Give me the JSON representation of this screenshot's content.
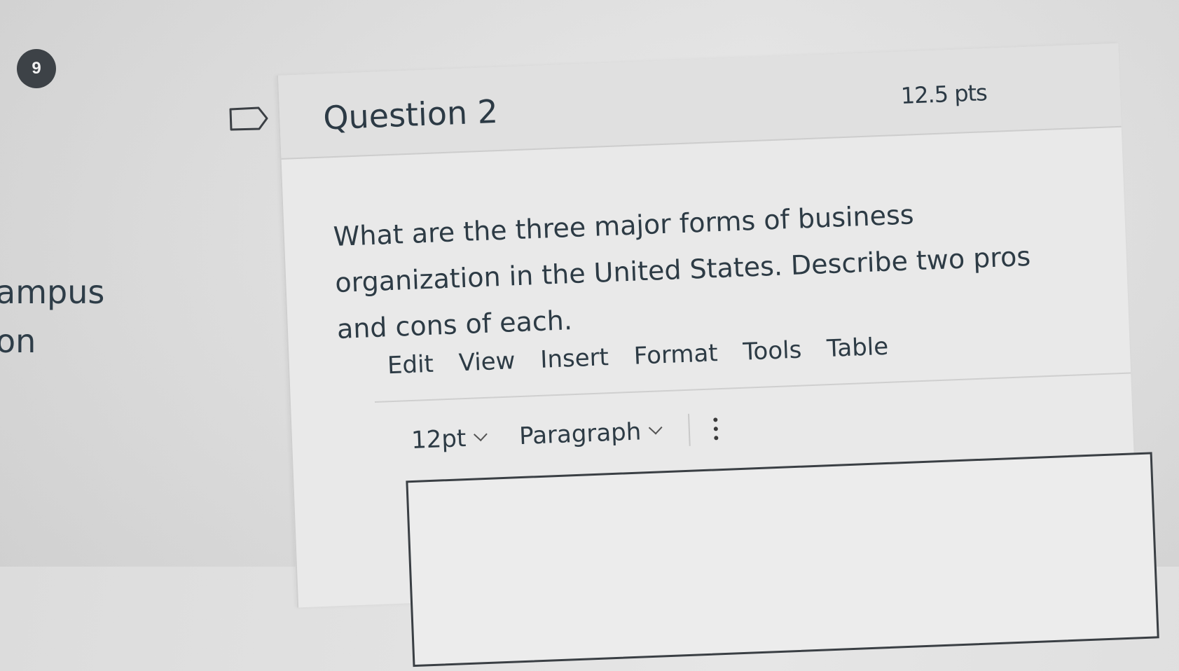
{
  "badge": {
    "count": "9"
  },
  "side": {
    "line1": "ampus",
    "line2": "on"
  },
  "question": {
    "title": "Question 2",
    "points": "12.5 pts",
    "text": "What are the three major forms of business organization in the United States. Describe two pros and cons of each."
  },
  "menubar": {
    "items": [
      "Edit",
      "View",
      "Insert",
      "Format",
      "Tools",
      "Table"
    ]
  },
  "toolbar": {
    "font_size": "12pt",
    "block_format": "Paragraph"
  },
  "editor": {
    "value": ""
  },
  "icons": {
    "flag": "flag-outline-icon",
    "chevron": "chevron-down-icon",
    "more": "vertical-ellipsis-icon"
  }
}
